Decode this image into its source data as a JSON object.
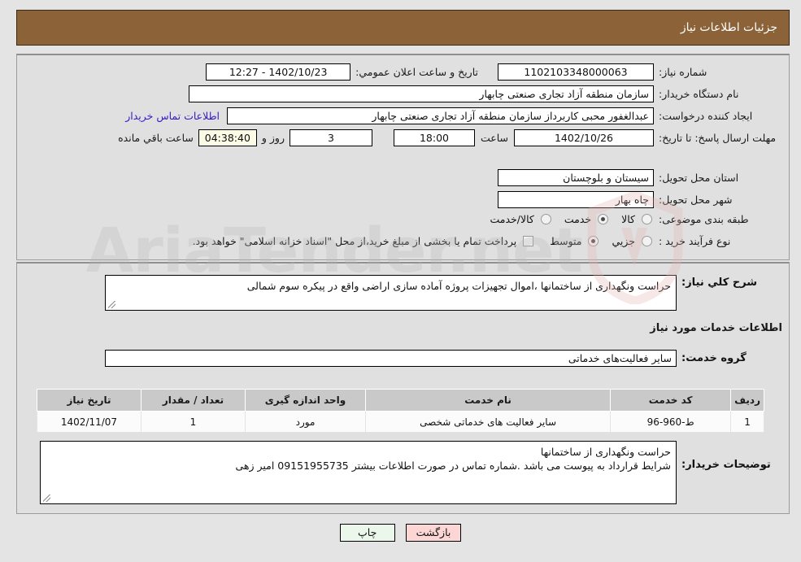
{
  "header": {
    "title": "جزئیات اطلاعات نیاز"
  },
  "watermark": {
    "text": "AriaTender.net",
    "shield_icon": "shield-icon"
  },
  "fields": {
    "need_number_label": "شماره نیاز:",
    "need_number_value": "1102103348000063",
    "public_announce_label": "تاریخ و ساعت اعلان عمومي:",
    "public_announce_value": "1402/10/23 - 12:27",
    "buyer_org_label": "نام دستگاه خریدار:",
    "buyer_org_value": "سازمان منطقه آزاد تجاری صنعتی چابهار",
    "request_creator_label": "ایجاد کننده درخواست:",
    "request_creator_value": "عبدالغفور محبی کاربرداز سازمان منطقه آزاد تجاری صنعتی چابهار",
    "buyer_contact_link": "اطلاعات تماس خریدار",
    "deadline_label": "مهلت ارسال پاسخ: تا تاریخ:",
    "deadline_date": "1402/10/26",
    "hour_label": "ساعت",
    "hour_value": "18:00",
    "days_value": "3",
    "days_label": "روز و",
    "timer_value": "04:38:40",
    "timer_label": "ساعت باقي مانده",
    "province_label": "استان محل تحویل:",
    "province_value": "سیستان و بلوچستان",
    "city_label": "شهر محل تحویل:",
    "city_value": "چاه بهار",
    "category_label": "طبقه بندی موضوعی:",
    "category_options": [
      {
        "label": "کالا",
        "selected": false
      },
      {
        "label": "خدمت",
        "selected": true
      },
      {
        "label": "کالا/خدمت",
        "selected": false
      }
    ],
    "process_label": "نوع فرآیند خرید :",
    "process_options": [
      {
        "label": "جزیي",
        "selected": false
      },
      {
        "label": "متوسط",
        "selected": true
      }
    ],
    "treasury_checkbox_label": "پرداخت تمام یا بخشی از مبلغ خرید،از محل \"اسناد خزانه اسلامی\" خواهد بود.",
    "treasury_checked": false
  },
  "description": {
    "label": "شرح کلي نیاز:",
    "value": "حراست ونگهداری از ساختمانها ،اموال تجهیزات پروژه آماده سازی اراضی واقع در پیکره سوم شمالی"
  },
  "services_section": {
    "heading": "اطلاعات خدمات مورد نیاز",
    "group_label": "گروه خدمت:",
    "group_value": "سایر فعالیت‌های خدماتی"
  },
  "table": {
    "headers": [
      "ردیف",
      "کد خدمت",
      "نام خدمت",
      "واحد اندازه گیری",
      "تعداد / مقدار",
      "تاریخ نیاز"
    ],
    "rows": [
      {
        "index": "1",
        "service_code": "ط-960-96",
        "service_name": "سایر فعالیت های خدماتی شخصی",
        "unit": "مورد",
        "quantity": "1",
        "need_date": "1402/11/07"
      }
    ]
  },
  "buyer_notes": {
    "label": "توضیحات خریدار:",
    "line1": "حراست ونگهداری از ساختمانها",
    "line2": "شرایط قرارداد به پیوست می باشد .شماره تماس در صورت اطلاعات بیشتر 09151955735  امیر زهی"
  },
  "footer": {
    "back_label": "بازگشت",
    "print_label": "چاپ"
  },
  "colors": {
    "header_bg": "#8c6239",
    "page_bg": "#e4e4e4",
    "panel_bg": "#e0e0e0",
    "link": "#3a18c8",
    "timer_bg": "#fbfbe6",
    "table_header_bg": "#c9c9c9",
    "back_btn_bg": "#fbd6d4",
    "print_btn_bg": "#eaf7ea"
  }
}
